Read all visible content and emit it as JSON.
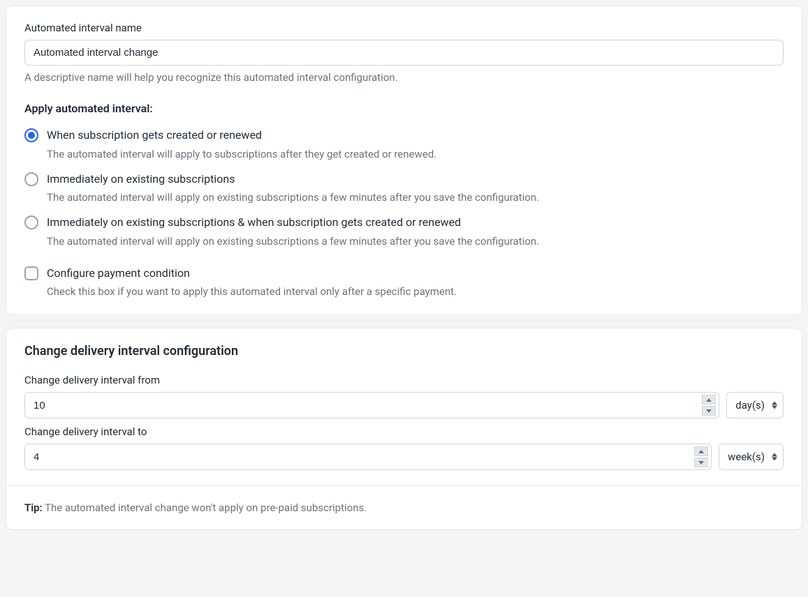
{
  "name_field": {
    "label": "Automated interval name",
    "value": "Automated interval change",
    "hint": "A descriptive name will help you recognize this automated interval configuration."
  },
  "apply_label": "Apply automated interval:",
  "apply_options": [
    {
      "label": "When subscription gets created or renewed",
      "desc": "The automated interval will apply to subscriptions after they get created or renewed.",
      "selected": true
    },
    {
      "label": "Immediately on existing subscriptions",
      "desc": "The automated interval will apply on existing subscriptions a few minutes after you save the configuration.",
      "selected": false
    },
    {
      "label": "Immediately on existing subscriptions & when subscription gets created or renewed",
      "desc": "The automated interval will apply on existing subscriptions a few minutes after you save the configuration.",
      "selected": false
    }
  ],
  "payment_condition": {
    "label": "Configure payment condition",
    "desc": "Check this box if you want to apply this automated interval only after a specific payment.",
    "checked": false
  },
  "change_section": {
    "title": "Change delivery interval configuration",
    "from": {
      "label": "Change delivery interval from",
      "value": "10",
      "unit": "day(s)"
    },
    "to": {
      "label": "Change delivery interval to",
      "value": "4",
      "unit": "week(s)"
    }
  },
  "tip": {
    "label": "Tip:",
    "text": " The automated interval change won't apply on pre-paid subscriptions."
  }
}
